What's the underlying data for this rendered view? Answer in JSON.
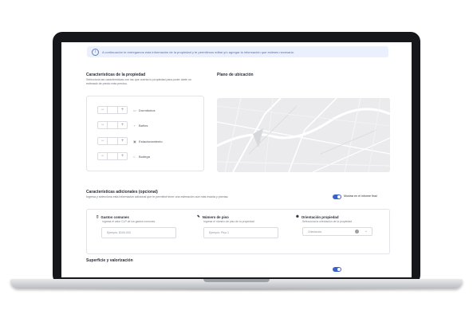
{
  "banner": {
    "text": "A continuación te entregamos esta información de la propiedad y te permitimos editar y/o agregar la información que estimes necesaria."
  },
  "properties": {
    "title": "Características de la propiedad",
    "subtitle": "Selecciona las características con las que cuenta tu propiedad para poder darte un estimado de precio más preciso.",
    "items": [
      {
        "label": "Dormitorios",
        "icon": "bed-icon"
      },
      {
        "label": "Baños",
        "icon": "bath-icon"
      },
      {
        "label": "Estacionamiento",
        "icon": "parking-icon"
      },
      {
        "label": "Bodega",
        "icon": "storage-icon"
      }
    ],
    "minus": "−",
    "plus": "+"
  },
  "map": {
    "title": "Plano de ubicación"
  },
  "additional": {
    "title": "Características adicionales (opcional)",
    "subtitle": "Ingresa y selecciona esta información adicional que te permitirá tener una estimación aún más exacta y precisa.",
    "toggle_label": "Mostrar en el informe final",
    "common_expenses": {
      "title": "Gastos comunes",
      "subtitle": "Ingresa el valor CLP de los gastos comunes",
      "placeholder": "Ejemplo: $100.000"
    },
    "floor_number": {
      "title": "Número de piso",
      "subtitle": "Ingresa el número de piso de tu propiedad",
      "placeholder": "Ejemplo: Piso 1"
    },
    "orientation": {
      "title": "Orientación propiedad",
      "subtitle": "Selecciona la orientación de la propiedad",
      "placeholder": "Orientación"
    }
  },
  "surface": {
    "title": "Superficie y valorización"
  },
  "colors": {
    "accent": "#3a63c9",
    "banner_bg": "#eaf0fc"
  }
}
